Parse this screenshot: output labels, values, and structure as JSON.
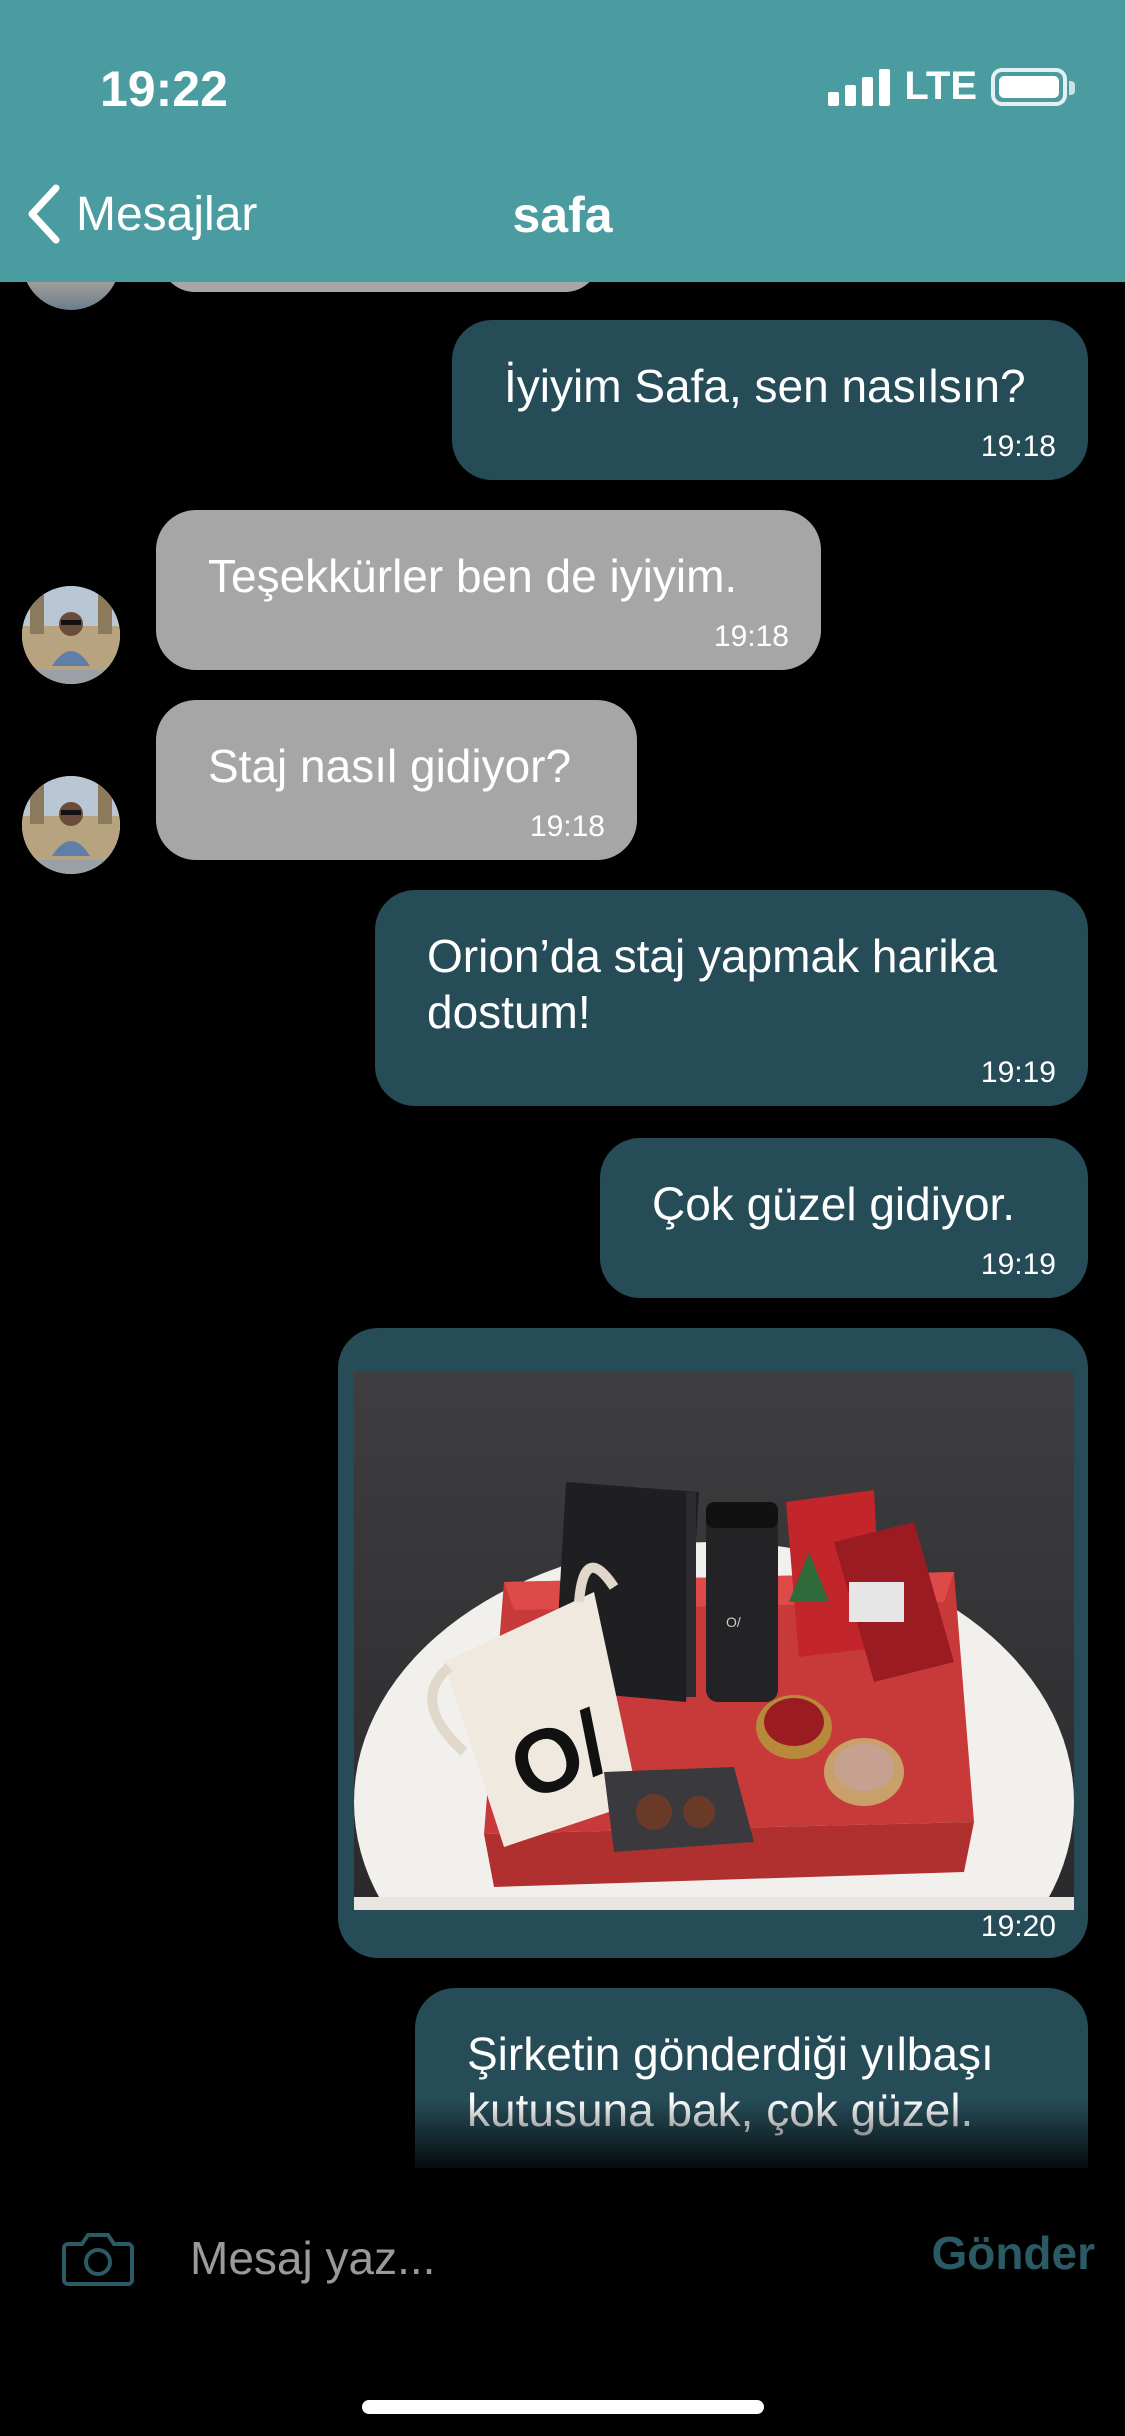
{
  "status_bar": {
    "time": "19:22",
    "network": "LTE"
  },
  "nav": {
    "back_label": "Mesajlar",
    "title": "safa"
  },
  "messages": [
    {
      "direction": "out",
      "text": "İyiyim Safa, sen nasılsın?",
      "time": "19:18"
    },
    {
      "direction": "in",
      "text": "Teşekkürler ben de iyiyim.",
      "time": "19:18"
    },
    {
      "direction": "in",
      "text": "Staj nasıl gidiyor?",
      "time": "19:18"
    },
    {
      "direction": "out",
      "text": "Orion’da staj yapmak harika dostum!",
      "time": "19:19"
    },
    {
      "direction": "out",
      "text": "Çok güzel gidiyor.",
      "time": "19:19"
    },
    {
      "direction": "out",
      "type": "image",
      "time": "19:20"
    },
    {
      "direction": "out",
      "text": "Şirketin gönderdiği yılbaşı kutusuna bak, çok güzel.",
      "time": ""
    }
  ],
  "composer": {
    "placeholder": "Mesaj yaz...",
    "send_label": "Gönder"
  },
  "colors": {
    "header": "#4a9ca1",
    "outgoing_bubble": "#264c58",
    "incoming_bubble": "#a6a6a6",
    "background": "#000000"
  }
}
